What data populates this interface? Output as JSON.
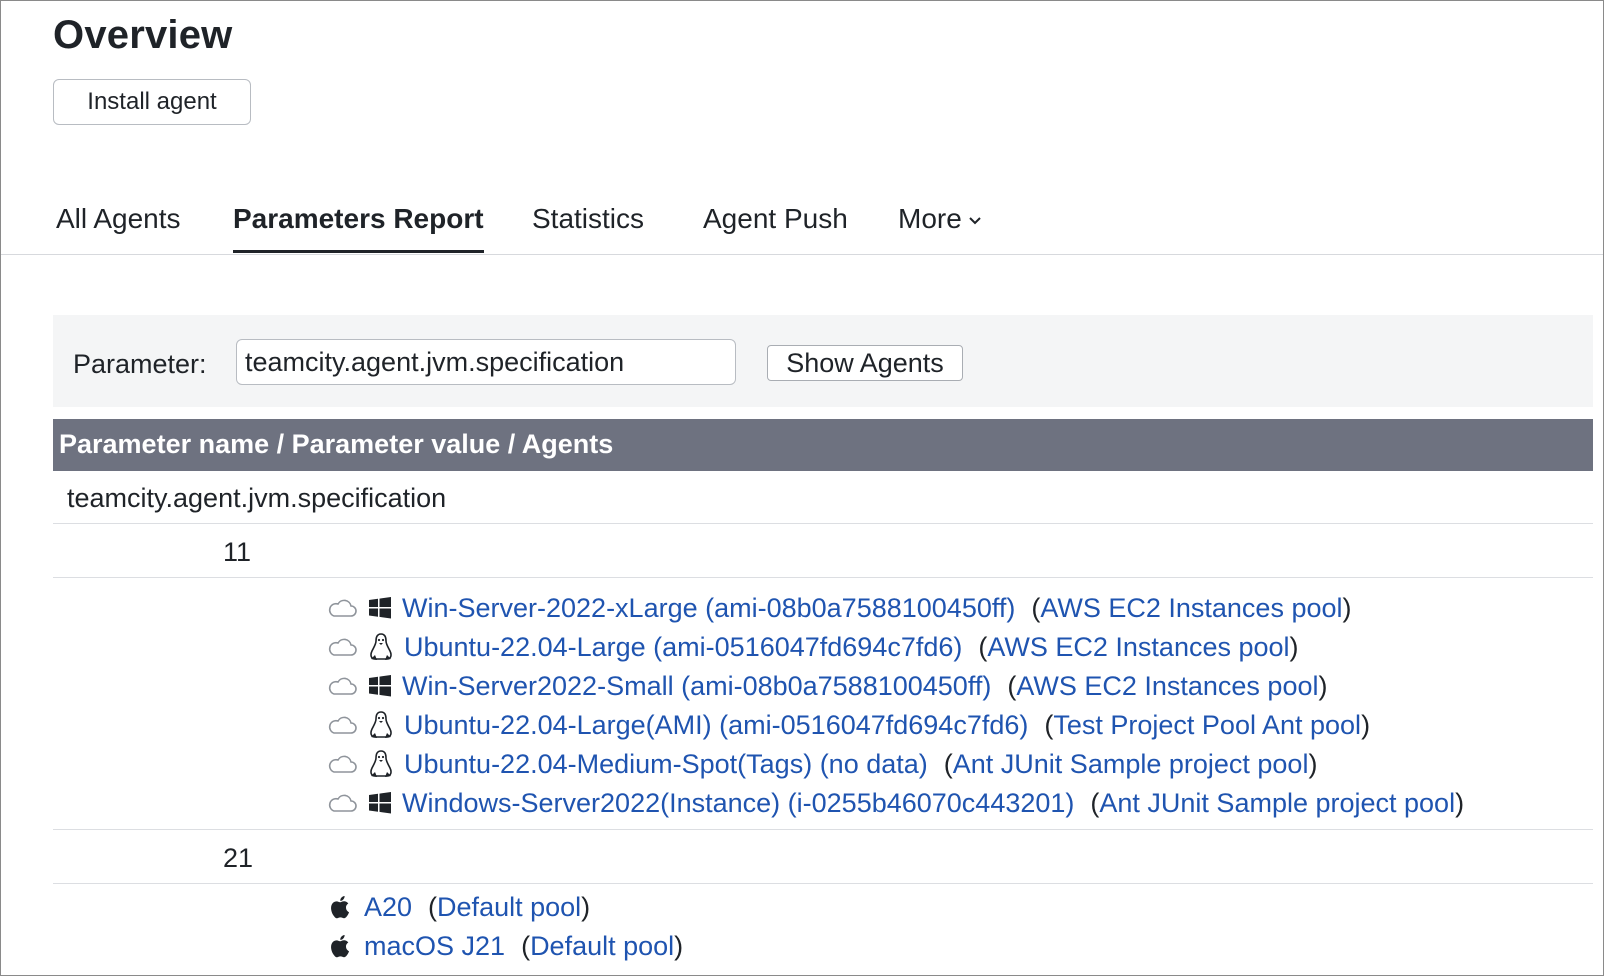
{
  "page": {
    "title": "Overview"
  },
  "actions": {
    "install_agent": "Install agent"
  },
  "tabs": [
    {
      "label": "All Agents"
    },
    {
      "label": "Parameters Report"
    },
    {
      "label": "Statistics"
    },
    {
      "label": "Agent Push"
    },
    {
      "label": "More"
    }
  ],
  "filter": {
    "label": "Parameter:",
    "value": "teamcity.agent.jvm.specification",
    "button": "Show Agents"
  },
  "table": {
    "header": "Parameter name / Parameter value / Agents",
    "parameter_name": "teamcity.agent.jvm.specification",
    "groups": [
      {
        "value": "11",
        "agents": [
          {
            "name": "Win-Server-2022-xLarge (ami-08b0a7588100450ff)",
            "pool": "AWS EC2 Instances pool",
            "os": "windows-icon",
            "cloud": true
          },
          {
            "name": "Ubuntu-22.04-Large (ami-0516047fd694c7fd6)",
            "pool": "AWS EC2 Instances pool",
            "os": "linux-icon",
            "cloud": true
          },
          {
            "name": "Win-Server2022-Small (ami-08b0a7588100450ff)",
            "pool": "AWS EC2 Instances pool",
            "os": "windows-icon",
            "cloud": true
          },
          {
            "name": "Ubuntu-22.04-Large(AMI) (ami-0516047fd694c7fd6)",
            "pool": "Test Project Pool Ant pool",
            "os": "linux-icon",
            "cloud": true
          },
          {
            "name": "Ubuntu-22.04-Medium-Spot(Tags) (no data)",
            "pool": "Ant JUnit Sample project pool",
            "os": "linux-icon",
            "cloud": true
          },
          {
            "name": "Windows-Server2022(Instance) (i-0255b46070c443201)",
            "pool": "Ant JUnit Sample project pool",
            "os": "windows-icon",
            "cloud": true
          }
        ]
      },
      {
        "value": "21",
        "agents": [
          {
            "name": "A20",
            "pool": "Default pool",
            "os": "apple-icon",
            "cloud": false
          },
          {
            "name": "macOS J21",
            "pool": "Default pool",
            "os": "apple-icon",
            "cloud": false
          }
        ]
      }
    ]
  },
  "paren_open": "(",
  "paren_close": ")"
}
